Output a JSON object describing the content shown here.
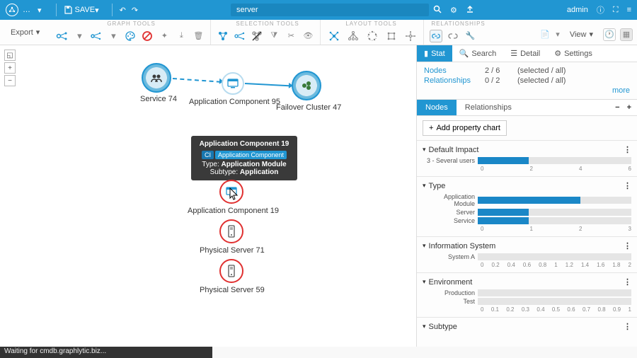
{
  "header": {
    "save_label": "SAVE",
    "search_value": "server",
    "admin_label": "admin"
  },
  "toolbar": {
    "export_label": "Export",
    "section_graph_tools": "GRAPH TOOLS",
    "section_selection_tools": "SELECTION TOOLS",
    "section_layout_tools": "LAYOUT TOOLS",
    "section_relationships": "RELATIONSHIPS",
    "view_label": "View"
  },
  "canvas": {
    "nodes": {
      "service74": "Service 74",
      "appcomp95": "Application Component 95",
      "failover47": "Failover Cluster 47",
      "appcomp19": "Application Component 19",
      "physsrv71": "Physical Server 71",
      "physsrv59": "Physical Server 59"
    },
    "tooltip": {
      "title": "Application Component 19",
      "ci_tag_prefix": "CI",
      "ci_tag": "Application Component",
      "type_label": "Type:",
      "type_value": "Application Module",
      "subtype_label": "Subtype:",
      "subtype_value": "Application"
    }
  },
  "sidepanel": {
    "tabs": {
      "stat": "Stat",
      "search": "Search",
      "detail": "Detail",
      "settings": "Settings"
    },
    "info": {
      "nodes_label": "Nodes",
      "nodes_value": "2 / 6",
      "nodes_note": "(selected / all)",
      "rel_label": "Relationships",
      "rel_value": "0 / 2",
      "rel_note": "(selected / all)",
      "more": "more"
    },
    "subtabs": {
      "nodes": "Nodes",
      "relationships": "Relationships"
    },
    "add_chart": "Add property chart"
  },
  "chart_data": [
    {
      "type": "bar",
      "title": "Default Impact",
      "categories": [
        "3 - Several users"
      ],
      "values": [
        2
      ],
      "xlim": [
        0,
        6
      ],
      "ticks": [
        0,
        2,
        4,
        6
      ]
    },
    {
      "type": "bar",
      "title": "Type",
      "categories": [
        "Application Module",
        "Server",
        "Service"
      ],
      "values": [
        2,
        1,
        1
      ],
      "xlim": [
        0,
        3
      ],
      "ticks": [
        0,
        1,
        2,
        3
      ]
    },
    {
      "type": "bar",
      "title": "Information System",
      "categories": [
        "System A"
      ],
      "values": [
        0
      ],
      "xlim": [
        0,
        2.0
      ],
      "ticks": [
        0,
        0.2,
        0.4,
        0.6,
        0.8,
        1.0,
        1.2,
        1.4,
        1.6,
        1.8,
        2.0
      ]
    },
    {
      "type": "bar",
      "title": "Environment",
      "categories": [
        "Production",
        "Test"
      ],
      "values": [
        0,
        0
      ],
      "xlim": [
        0,
        1.0
      ],
      "ticks": [
        0,
        0.1,
        0.2,
        0.3,
        0.4,
        0.5,
        0.6,
        0.7,
        0.8,
        0.9,
        1.0
      ]
    },
    {
      "type": "bar",
      "title": "Subtype",
      "categories": [],
      "values": [],
      "xlim": [
        0,
        1
      ],
      "ticks": []
    }
  ],
  "statusbar": {
    "text": "Waiting for cmdb.graphlytic.biz..."
  }
}
